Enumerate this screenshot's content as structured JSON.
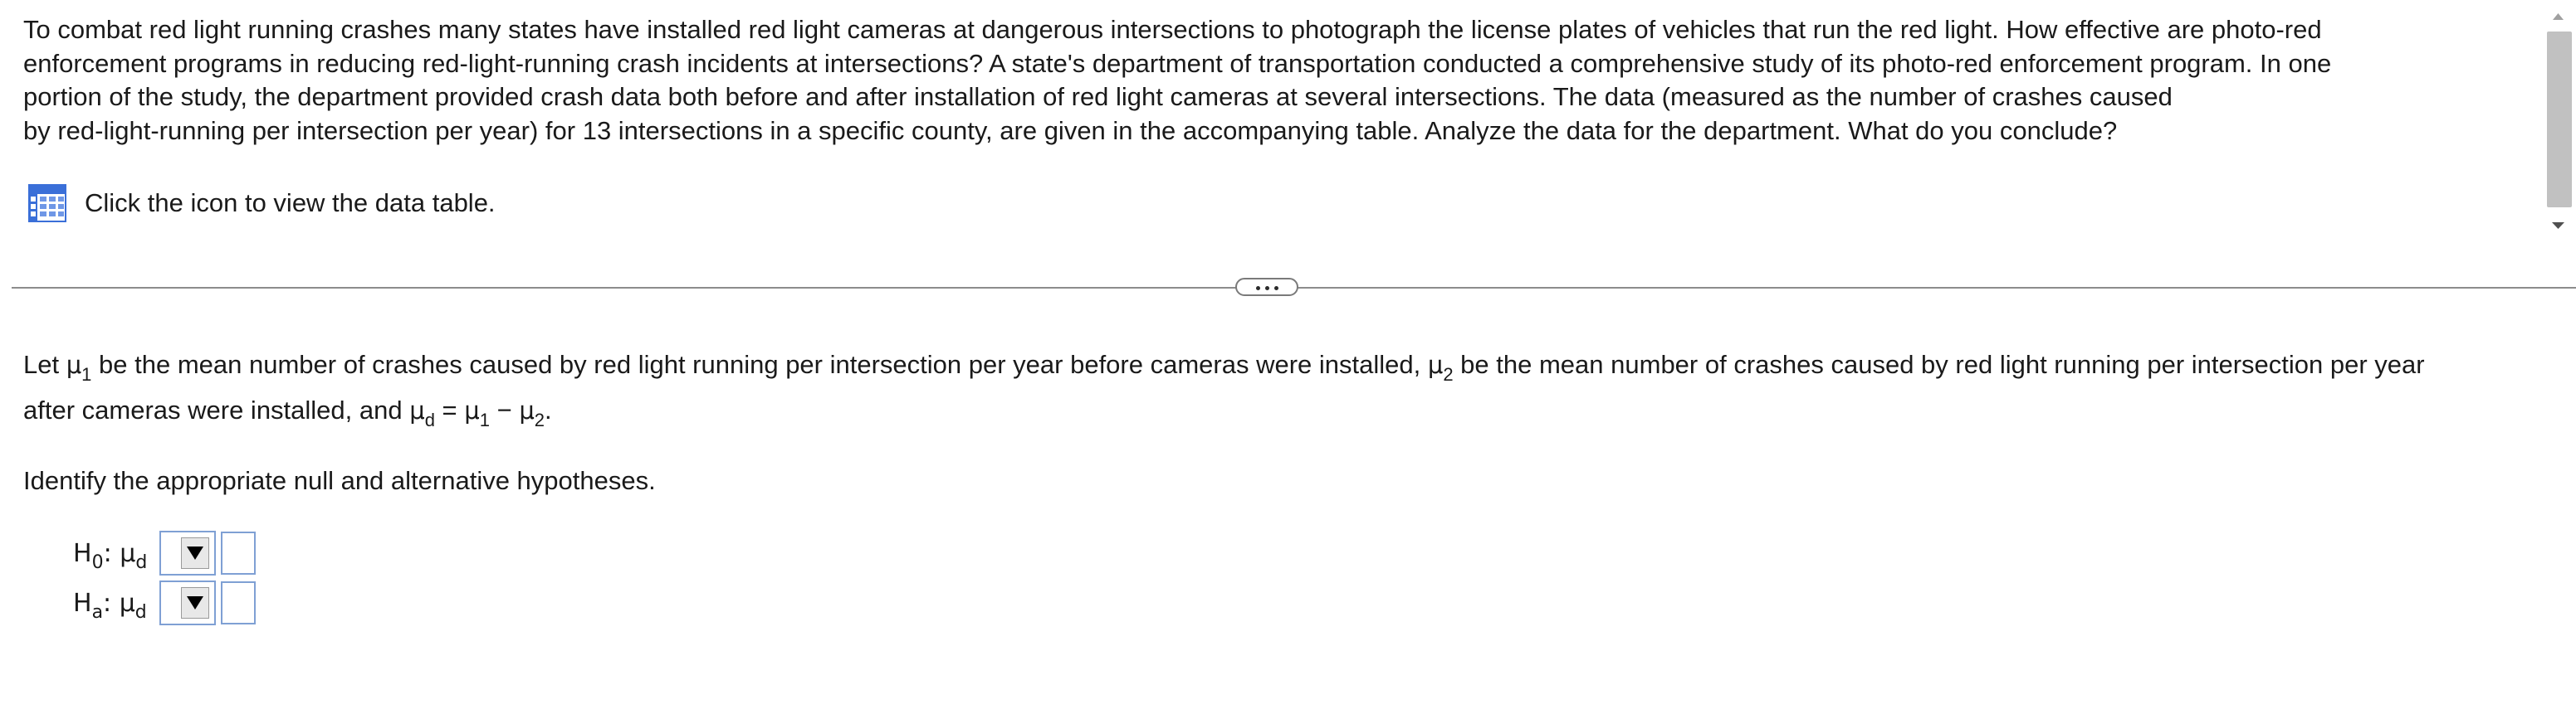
{
  "question": {
    "lines": [
      "To combat red light running crashes many states have installed red light cameras at dangerous intersections to photograph the license plates of vehicles that run the red light. How effective are photo-red",
      "enforcement programs in reducing red-light-running crash incidents at intersections? A state's department of transportation conducted a comprehensive study of its photo-red enforcement program. In one",
      "portion of the study, the department provided crash data both before and after installation of red light cameras at several intersections. The data (measured as the number of crashes caused",
      "by red-light-running per intersection per year) for 13 intersections in a specific county, are given in the accompanying table. Analyze the data for the department. What do you conclude?"
    ],
    "data_link_label": "Click the icon to view the data table.",
    "data_link_icon": "table-grid-icon"
  },
  "answer": {
    "def_line1": {
      "let": "Let ",
      "mu": "μ",
      "sub1": "1",
      "text1": " be the mean number of crashes caused by red light running per intersection per year before cameras were installed, ",
      "sub2": "2",
      "text2": " be the mean number of crashes caused by red light running per intersection per year"
    },
    "def_line2": {
      "text": "after cameras were installed, and ",
      "mu_d": "μ",
      "sub_d": "d",
      "eq": " = ",
      "mu1": "μ",
      "sub1": "1",
      "minus": " − ",
      "mu2": "μ",
      "sub2": "2",
      "period": "."
    },
    "instruction": "Identify the appropriate null and alternative hypotheses.",
    "hypotheses": {
      "null": {
        "H": "H",
        "sub": "0",
        "colon": ": ",
        "mu": "μ",
        "mu_sub": "d",
        "operator": "",
        "value": ""
      },
      "alt": {
        "H": "H",
        "sub": "a",
        "colon": ": ",
        "mu": "μ",
        "mu_sub": "d",
        "operator": "",
        "value": ""
      }
    }
  },
  "colors": {
    "icon_blue": "#3a6fd8",
    "field_border": "#7fa0d4",
    "scroll_thumb": "#c1c1c1"
  }
}
